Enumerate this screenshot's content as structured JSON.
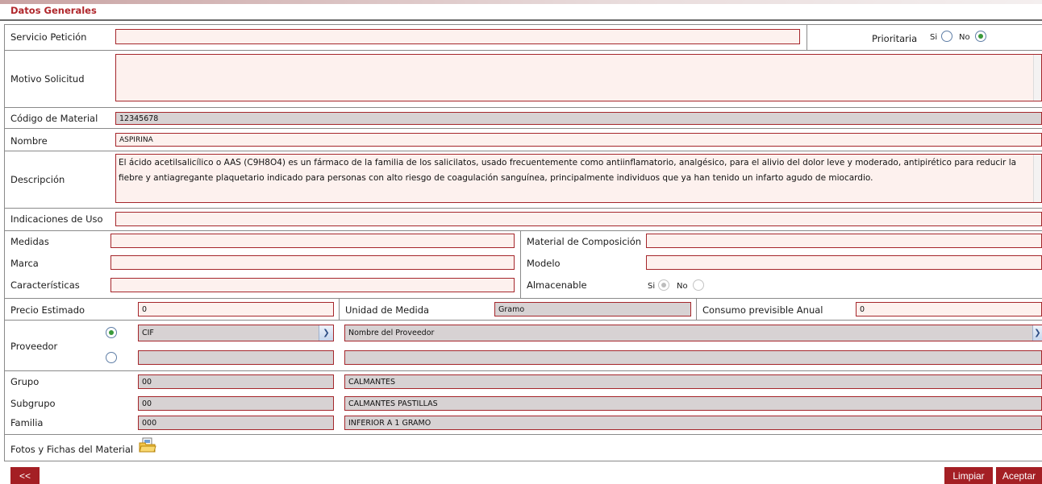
{
  "section": {
    "title": "Datos Generales"
  },
  "fields": {
    "servicio": {
      "label": "Servicio Petición",
      "value": ""
    },
    "prioritaria": {
      "label": "Prioritaria",
      "si": "Si",
      "no": "No",
      "selected": "No"
    },
    "motivo": {
      "label": "Motivo Solicitud",
      "value": ""
    },
    "codigo": {
      "label": "Código de Material",
      "value": "12345678"
    },
    "nombre": {
      "label": "Nombre",
      "value": "ASPIRINA"
    },
    "descripcion": {
      "label": "Descripción",
      "value": "El ácido acetilsalicílico o AAS (C9H8O4) es un fármaco de la familia de los salicilatos, usado frecuentemente como antiinflamatorio, analgésico, para el alivio del dolor leve y moderado, antipirético para reducir la fiebre y antiagregante plaquetario indicado para personas con alto riesgo de coagulación sanguínea, principalmente individuos que ya han tenido un infarto agudo de miocardio."
    },
    "indicaciones": {
      "label": "Indicaciones de Uso",
      "value": ""
    },
    "medidas": {
      "label": "Medidas",
      "value": ""
    },
    "material_composicion": {
      "label": "Material de Composición",
      "value": ""
    },
    "marca": {
      "label": "Marca",
      "value": ""
    },
    "modelo": {
      "label": "Modelo",
      "value": ""
    },
    "caracteristicas": {
      "label": "Características",
      "value": ""
    },
    "almacenable": {
      "label": "Almacenable",
      "si": "Si",
      "no": "No",
      "selected": "Si"
    },
    "precio": {
      "label": "Precio Estimado",
      "value": "0"
    },
    "unidad": {
      "label": "Unidad de Medida",
      "value": "Gramo"
    },
    "consumo": {
      "label": "Consumo previsible Anual",
      "value": "0"
    },
    "proveedor": {
      "label": "Proveedor",
      "select_cif": "CIF",
      "select_nombre": "Nombre del Proveedor",
      "cif_value": "",
      "nombre_value": "",
      "selected_option": "CIF"
    },
    "grupo": {
      "label": "Grupo",
      "code": "00",
      "name": "CALMANTES"
    },
    "subgrupo": {
      "label": "Subgrupo",
      "code": "00",
      "name": "CALMANTES PASTILLAS"
    },
    "familia": {
      "label": "Familia",
      "code": "000",
      "name": "INFERIOR A 1 GRAMO"
    },
    "fotos": {
      "label": "Fotos y Fichas del Material",
      "icon": "folder-icon"
    }
  },
  "buttons": {
    "back": "<<",
    "limpiar": "Limpiar",
    "aceptar": "Aceptar"
  },
  "colors": {
    "accent": "#a41f24",
    "field_bg": "#fdf1ee",
    "readonly_bg": "#d7d2d3",
    "title": "#b0272c"
  }
}
